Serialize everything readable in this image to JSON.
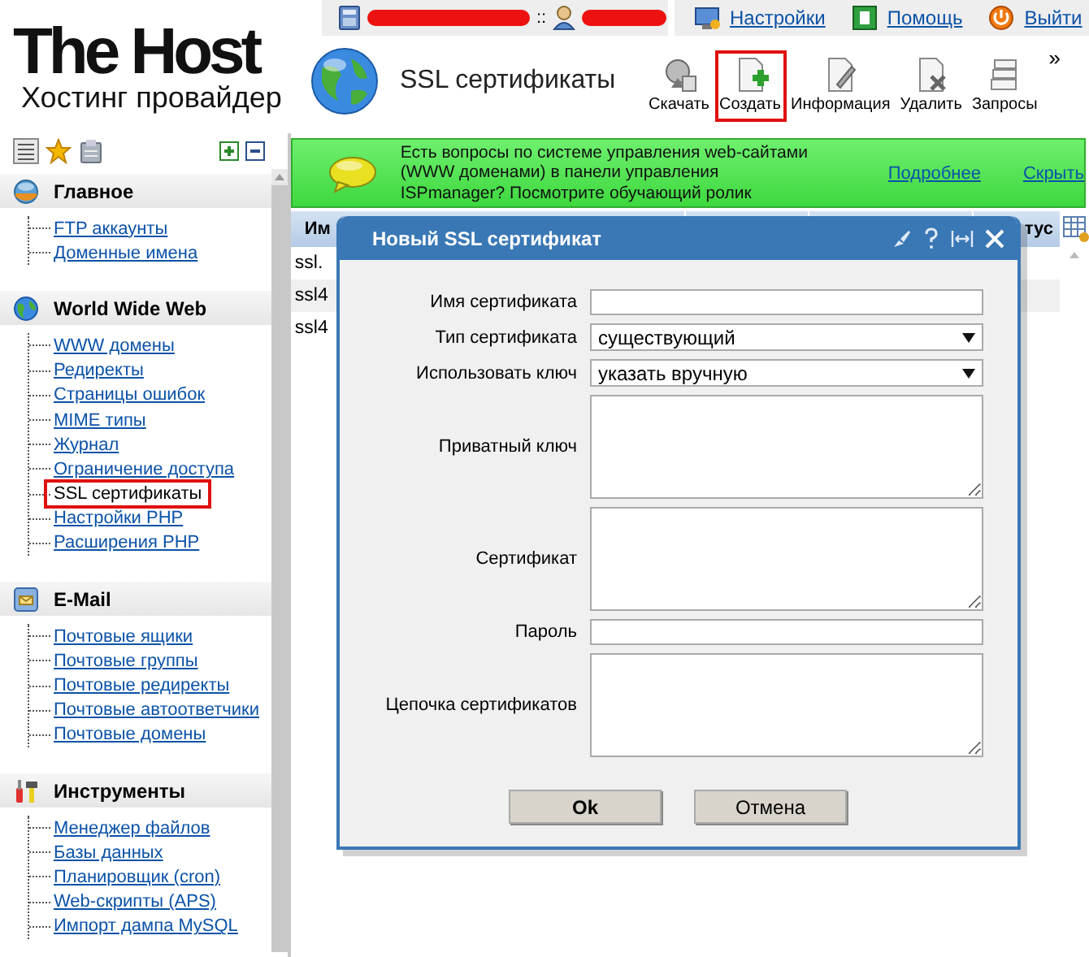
{
  "logo": {
    "name": "The Host",
    "tagline": "Хостинг провайдер"
  },
  "top_bar": {
    "separator": "::",
    "links": [
      "Настройки",
      "Помощь",
      "Выйти"
    ]
  },
  "page_title": "SSL сертификаты",
  "toolbar": [
    {
      "label": "Скачать",
      "highlighted": false
    },
    {
      "label": "Создать",
      "highlighted": true
    },
    {
      "label": "Информация",
      "highlighted": false
    },
    {
      "label": "Удалить",
      "highlighted": false
    },
    {
      "label": "Запросы",
      "highlighted": false
    }
  ],
  "toolbar_more": "»",
  "sidebar": {
    "sections": [
      {
        "title": "Главное",
        "items": [
          {
            "label": "FTP аккаунты",
            "selected": false
          },
          {
            "label": "Доменные имена",
            "selected": false
          }
        ]
      },
      {
        "title": "World Wide Web",
        "items": [
          {
            "label": "WWW домены",
            "selected": false
          },
          {
            "label": "Редиректы",
            "selected": false
          },
          {
            "label": "Страницы ошибок",
            "selected": false
          },
          {
            "label": "MIME типы",
            "selected": false
          },
          {
            "label": "Журнал",
            "selected": false
          },
          {
            "label": "Ограничение доступа",
            "selected": false
          },
          {
            "label": "SSL сертификаты",
            "selected": true
          },
          {
            "label": "Настройки PHP",
            "selected": false
          },
          {
            "label": "Расширения PHP",
            "selected": false
          }
        ]
      },
      {
        "title": "E-Mail",
        "items": [
          {
            "label": "Почтовые ящики",
            "selected": false
          },
          {
            "label": "Почтовые группы",
            "selected": false
          },
          {
            "label": "Почтовые редиректы",
            "selected": false
          },
          {
            "label": "Почтовые автоответчики",
            "selected": false
          },
          {
            "label": "Почтовые домены",
            "selected": false
          }
        ]
      },
      {
        "title": "Инструменты",
        "items": [
          {
            "label": "Менеджер файлов",
            "selected": false
          },
          {
            "label": "Базы данных",
            "selected": false
          },
          {
            "label": "Планировщик (cron)",
            "selected": false
          },
          {
            "label": "Web-скрипты (APS)",
            "selected": false
          },
          {
            "label": "Импорт дампа MySQL",
            "selected": false
          }
        ]
      }
    ]
  },
  "banner": {
    "text": "Есть вопросы по системе управления web-сайтами (WWW доменами) в панели управления ISPmanager? Посмотрите обучающий ролик",
    "links": [
      "Подробнее",
      "Скрыть"
    ]
  },
  "table": {
    "columns": [
      "Им",
      "тус"
    ],
    "rows": [
      "ssl.",
      "ssl4",
      "ssl4"
    ]
  },
  "dialog": {
    "title": "Новый SSL сертификат",
    "fields": [
      {
        "label": "Имя сертификата",
        "kind": "text"
      },
      {
        "label": "Тип сертификата",
        "kind": "select",
        "value": "существующий"
      },
      {
        "label": "Использовать ключ",
        "kind": "select",
        "value": "указать вручную"
      },
      {
        "label": "Приватный ключ",
        "kind": "textarea"
      },
      {
        "label": "Сертификат",
        "kind": "textarea"
      },
      {
        "label": "Пароль",
        "kind": "password"
      },
      {
        "label": "Цепочка сертификатов",
        "kind": "textarea"
      }
    ],
    "buttons": [
      "Ok",
      "Отмена"
    ]
  }
}
